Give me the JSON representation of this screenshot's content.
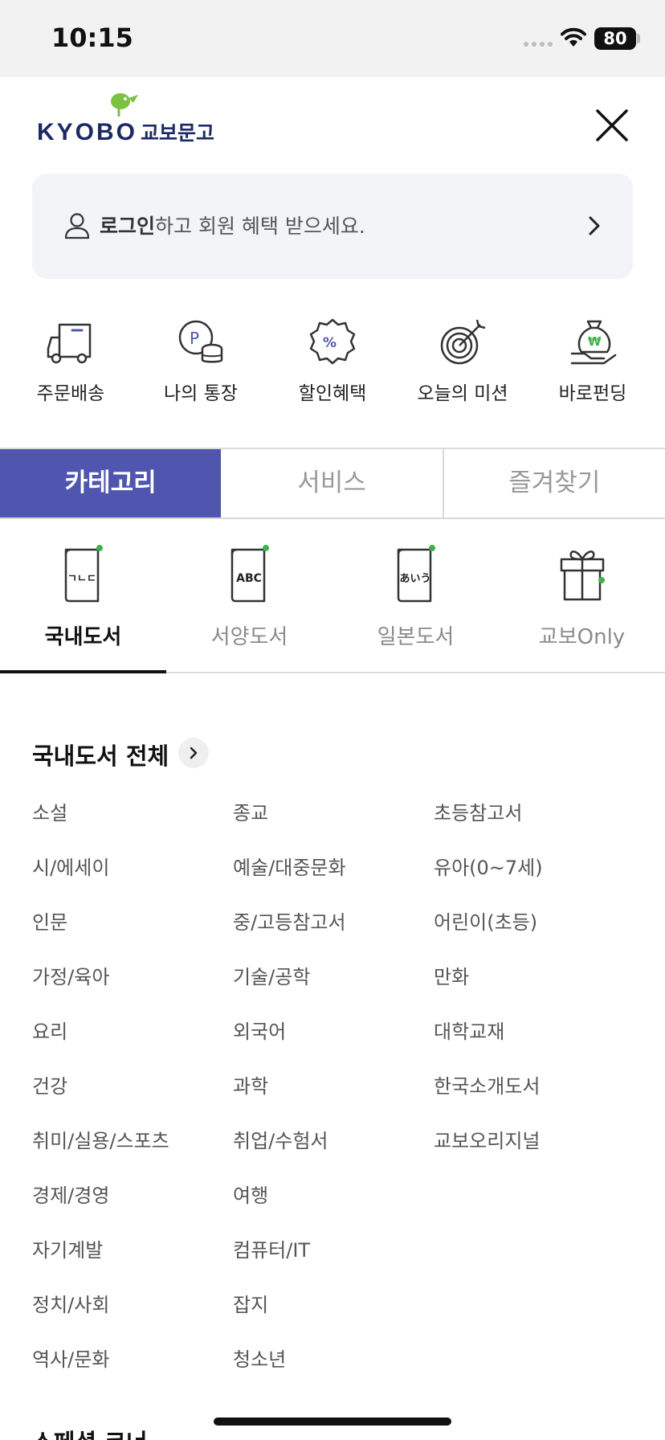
{
  "status_bar": {
    "time": "10:15",
    "battery": "80"
  },
  "header": {
    "logo_text": "KYOBO",
    "logo_korean": "교보문고"
  },
  "login": {
    "bold": "로그인",
    "rest": "하고 회원 혜택 받으세요."
  },
  "quick_menu": [
    {
      "label": "주문배송",
      "icon": "truck-icon"
    },
    {
      "label": "나의 통장",
      "icon": "point-coin-icon"
    },
    {
      "label": "할인혜택",
      "icon": "discount-badge-icon"
    },
    {
      "label": "오늘의 미션",
      "icon": "target-icon"
    },
    {
      "label": "바로펀딩",
      "icon": "money-bag-icon"
    }
  ],
  "main_tabs": [
    {
      "label": "카테고리",
      "active": true
    },
    {
      "label": "서비스",
      "active": false
    },
    {
      "label": "즐겨찾기",
      "active": false
    }
  ],
  "category_tabs": [
    {
      "label": "국내도서",
      "icon_text": "ㄱㄴㄷ",
      "active": true
    },
    {
      "label": "서양도서",
      "icon_text": "ABC",
      "active": false
    },
    {
      "label": "일본도서",
      "icon_text": "あいう",
      "active": false
    },
    {
      "label": "교보Only",
      "icon_text": "",
      "active": false
    }
  ],
  "section": {
    "title": "국내도서 전체",
    "columns": [
      [
        "소설",
        "시/에세이",
        "인문",
        "가정/육아",
        "요리",
        "건강",
        "취미/실용/스포츠",
        "경제/경영",
        "자기계발",
        "정치/사회",
        "역사/문화"
      ],
      [
        "종교",
        "예술/대중문화",
        "중/고등참고서",
        "기술/공학",
        "외국어",
        "과학",
        "취업/수험서",
        "여행",
        "컴퓨터/IT",
        "잡지",
        "청소년"
      ],
      [
        "초등참고서",
        "유아(0~7세)",
        "어린이(초등)",
        "만화",
        "대학교재",
        "한국소개도서",
        "교보오리지널"
      ]
    ]
  },
  "next_section_title": "스페셜 코너",
  "colors": {
    "accent": "#5056b0",
    "logo_navy": "#1b2a63",
    "logo_green": "#7cc242",
    "dot_green": "#3cb34a"
  }
}
